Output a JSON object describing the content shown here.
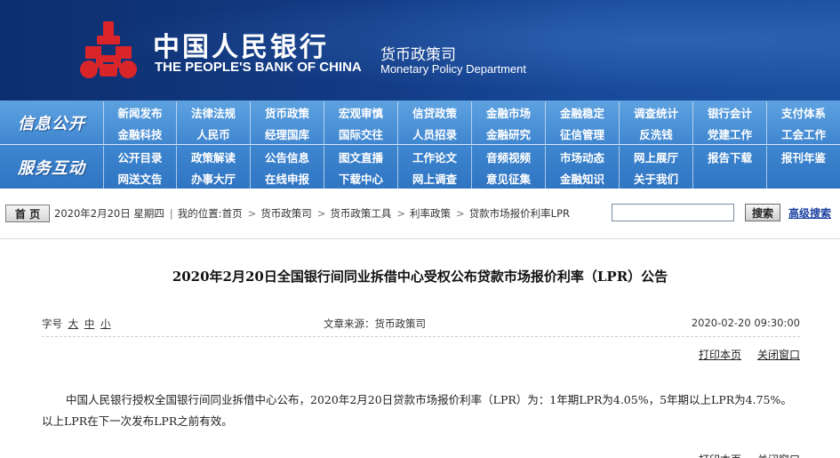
{
  "header": {
    "bank_name_cn": "中国人民银行",
    "bank_name_en": "THE PEOPLE'S BANK OF CHINA",
    "department_cn": "货币政策司",
    "department_en": "Monetary Policy Department",
    "logo_colors": {
      "emblem": "#d9252a",
      "background": "#133c86"
    }
  },
  "nav": {
    "sections": [
      {
        "label": "信息公开",
        "rows": [
          [
            "新闻发布",
            "法律法规",
            "货币政策",
            "宏观审慎",
            "信贷政策",
            "金融市场",
            "金融稳定",
            "调查统计",
            "银行会计",
            "支付体系"
          ],
          [
            "金融科技",
            "人民币",
            "经理国库",
            "国际交往",
            "人员招录",
            "金融研究",
            "征信管理",
            "反洗钱",
            "党建工作",
            "工会工作"
          ]
        ]
      },
      {
        "label": "服务互动",
        "rows": [
          [
            "公开目录",
            "政策解读",
            "公告信息",
            "图文直播",
            "工作论文",
            "音频视频",
            "市场动态",
            "网上展厅",
            "报告下载",
            "报刊年鉴"
          ],
          [
            "网送文告",
            "办事大厅",
            "在线申报",
            "下载中心",
            "网上调查",
            "意见征集",
            "金融知识",
            "关于我们",
            "",
            ""
          ]
        ]
      }
    ]
  },
  "infobar": {
    "home_label": "首 页",
    "date": "2020年2月20日 星期四",
    "location_label": "我的位置:",
    "breadcrumbs": [
      "首页",
      "货币政策司",
      "货币政策工具",
      "利率政策",
      "贷款市场报价利率LPR"
    ],
    "search_value": "",
    "search_button_label": "搜索",
    "advanced_search_label": "高级搜索"
  },
  "article": {
    "title": "2020年2月20日全国银行间同业拆借中心受权公布贷款市场报价利率（LPR）公告",
    "font_size_label": "字号",
    "font_sizes": [
      "大",
      "中",
      "小"
    ],
    "source": "文章来源：货币政策司",
    "date": "2020-02-20 09:30:00",
    "print_label": "打印本页",
    "close_label": "关闭窗口",
    "body": "中国人民银行授权全国银行间同业拆借中心公布，2020年2月20日贷款市场报价利率（LPR）为：1年期LPR为4.05%，5年期以上LPR为4.75%。以上LPR在下一次发布LPR之前有效。"
  }
}
